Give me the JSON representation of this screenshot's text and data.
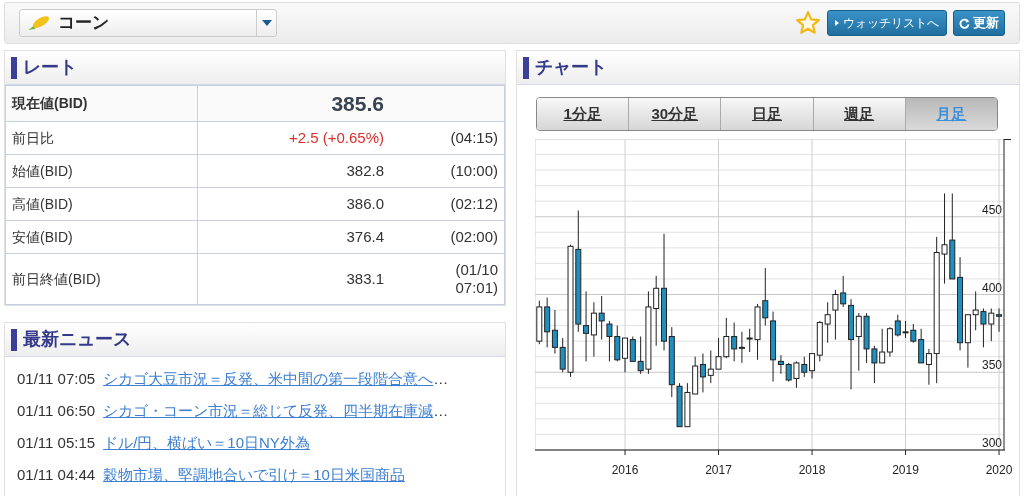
{
  "header": {
    "commodity": "コーン",
    "watchlist_button": "ウォッチリストへ",
    "refresh_button": "更新"
  },
  "rate": {
    "title": "レート",
    "rows": [
      {
        "kind": "current",
        "label": "現在値(BID)",
        "value": "385.6"
      },
      {
        "kind": "change",
        "label": "前日比",
        "value": "+2.5 (+0.65%)",
        "time": "(04:15)"
      },
      {
        "kind": "plain",
        "label": "始値(BID)",
        "value": "382.8",
        "time": "(10:00)"
      },
      {
        "kind": "plain",
        "label": "高値(BID)",
        "value": "386.0",
        "time": "(02:12)"
      },
      {
        "kind": "plain",
        "label": "安値(BID)",
        "value": "376.4",
        "time": "(02:00)"
      },
      {
        "kind": "plain",
        "label": "前日終値(BID)",
        "value": "383.1",
        "time": "(01/10 07:01)"
      }
    ]
  },
  "news": {
    "title": "最新ニュース",
    "items": [
      {
        "time": "01/11 07:05",
        "title": "シカゴ大豆市況＝反発、米中間の第一段階合意へ",
        "more": "…"
      },
      {
        "time": "01/11 06:50",
        "title": "シカゴ・コーン市況＝総じて反発、四半期在庫減",
        "more": "…"
      },
      {
        "time": "01/11 05:15",
        "title": "ドル/円、横ばい＝10日NY外為"
      },
      {
        "time": "01/11 04:44",
        "title": "穀物市場、堅調地合いで引け＝10日米国商品"
      }
    ]
  },
  "chart": {
    "title": "チャート",
    "tabs": [
      {
        "label": "1分足",
        "selected": false
      },
      {
        "label": "30分足",
        "selected": false
      },
      {
        "label": "日足",
        "selected": false
      },
      {
        "label": "週足",
        "selected": false
      },
      {
        "label": "月足",
        "selected": true
      }
    ],
    "chart_data": {
      "type": "candlestick",
      "ylim": [
        300,
        500
      ],
      "xlim": [
        2015.037,
        2020.053
      ],
      "grid": true,
      "yticks": [
        300,
        350,
        400,
        450
      ],
      "xticks": [
        2016,
        2017,
        2018,
        2019,
        2020
      ],
      "x": [
        2015.083,
        2015.167,
        2015.25,
        2015.333,
        2015.417,
        2015.5,
        2015.583,
        2015.667,
        2015.75,
        2015.833,
        2015.917,
        2016,
        2016.083,
        2016.167,
        2016.25,
        2016.333,
        2016.417,
        2016.5,
        2016.583,
        2016.667,
        2016.75,
        2016.833,
        2016.917,
        2017,
        2017.083,
        2017.167,
        2017.25,
        2017.333,
        2017.417,
        2017.5,
        2017.583,
        2017.667,
        2017.75,
        2017.833,
        2017.917,
        2018,
        2018.083,
        2018.167,
        2018.25,
        2018.333,
        2018.417,
        2018.5,
        2018.583,
        2018.667,
        2018.75,
        2018.833,
        2018.917,
        2019,
        2019.083,
        2019.167,
        2019.25,
        2019.333,
        2019.417,
        2019.5,
        2019.583,
        2019.667,
        2019.75,
        2019.833,
        2019.917,
        2020
      ],
      "ohlc": [
        [
          370,
          396,
          368,
          392
        ],
        [
          392,
          398,
          366,
          376
        ],
        [
          377,
          390,
          362,
          366
        ],
        [
          366,
          372,
          350,
          352
        ],
        [
          350,
          432,
          347,
          431
        ],
        [
          429,
          454,
          376,
          381
        ],
        [
          380,
          402,
          357,
          375
        ],
        [
          374,
          395,
          360,
          388
        ],
        [
          388,
          399,
          371,
          383
        ],
        [
          381,
          383,
          357,
          373
        ],
        [
          373,
          380,
          357,
          358
        ],
        [
          359,
          372,
          350,
          372
        ],
        [
          371,
          373,
          357,
          357
        ],
        [
          357,
          373,
          349,
          351
        ],
        [
          352,
          402,
          349,
          392
        ],
        [
          391,
          412,
          367,
          404
        ],
        [
          404,
          439,
          364,
          370
        ],
        [
          373,
          379,
          334,
          342
        ],
        [
          341,
          343,
          315,
          315
        ],
        [
          315,
          343,
          315,
          337
        ],
        [
          336,
          360,
          336,
          354
        ],
        [
          355,
          362,
          337,
          347
        ],
        [
          348,
          364,
          343,
          352
        ],
        [
          352,
          372,
          352,
          360
        ],
        [
          360,
          385,
          359,
          373
        ],
        [
          373,
          382,
          357,
          365
        ],
        [
          366,
          376,
          356,
          366
        ],
        [
          372,
          378,
          363,
          372
        ],
        [
          371,
          394,
          358,
          392
        ],
        [
          396,
          417,
          380,
          385
        ],
        [
          383,
          389,
          344,
          358
        ],
        [
          357,
          361,
          349,
          355
        ],
        [
          355,
          356,
          344,
          345
        ],
        [
          346,
          357,
          340,
          356
        ],
        [
          355,
          360,
          347,
          350
        ],
        [
          351,
          362,
          346,
          362
        ],
        [
          361,
          383,
          357,
          382
        ],
        [
          381,
          395,
          369,
          387
        ],
        [
          390,
          403,
          371,
          400
        ],
        [
          401,
          412,
          392,
          394
        ],
        [
          393,
          397,
          339,
          371
        ],
        [
          373,
          388,
          351,
          386
        ],
        [
          386,
          388,
          356,
          365
        ],
        [
          365,
          367,
          343,
          356
        ],
        [
          356,
          378,
          356,
          363
        ],
        [
          363,
          379,
          360,
          378
        ],
        [
          383,
          387,
          373,
          374
        ],
        [
          376,
          383,
          372,
          376
        ],
        [
          377,
          381,
          369,
          370
        ],
        [
          371,
          378,
          356,
          356
        ],
        [
          355,
          365,
          342,
          362
        ],
        [
          362,
          437,
          343,
          427
        ],
        [
          426,
          465,
          407,
          432
        ],
        [
          435,
          465,
          410,
          410
        ],
        [
          411,
          424,
          364,
          369
        ],
        [
          369,
          387,
          353,
          387
        ],
        [
          387,
          402,
          377,
          390
        ],
        [
          389,
          391,
          366,
          381
        ],
        [
          381,
          391,
          370,
          388
        ],
        [
          387,
          391,
          376,
          386
        ]
      ]
    }
  }
}
